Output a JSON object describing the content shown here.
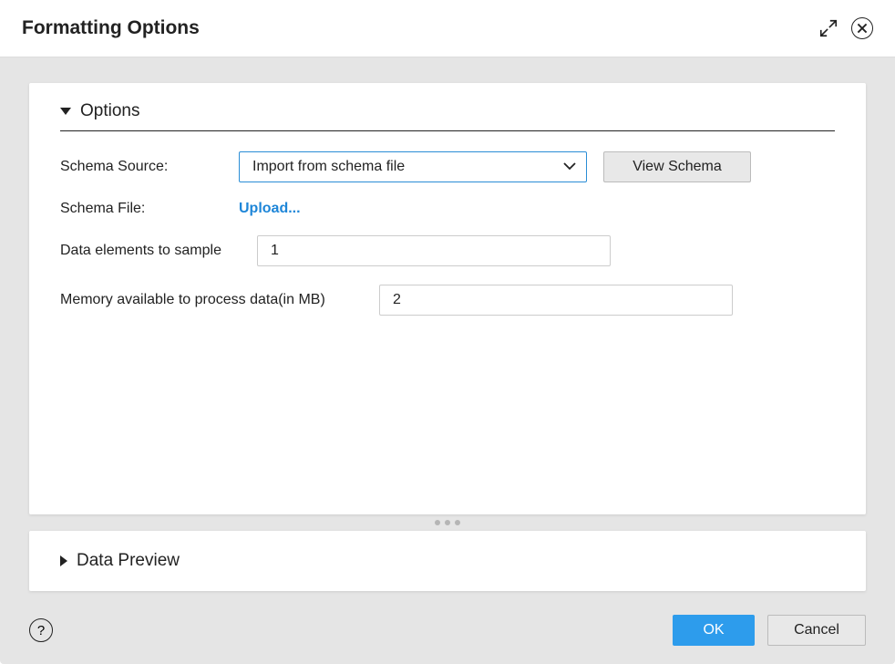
{
  "dialog": {
    "title": "Formatting Options"
  },
  "sections": {
    "options_title": "Options",
    "preview_title": "Data Preview"
  },
  "form": {
    "schema_source_label": "Schema Source:",
    "schema_source_value": "Import from schema file",
    "view_schema_label": "View Schema",
    "schema_file_label": "Schema File:",
    "upload_link": "Upload...",
    "data_elements_label": "Data elements to sample",
    "data_elements_value": "1",
    "memory_label": "Memory available to process data(in MB)",
    "memory_value": "2"
  },
  "footer": {
    "ok_label": "OK",
    "cancel_label": "Cancel",
    "help_glyph": "?"
  }
}
